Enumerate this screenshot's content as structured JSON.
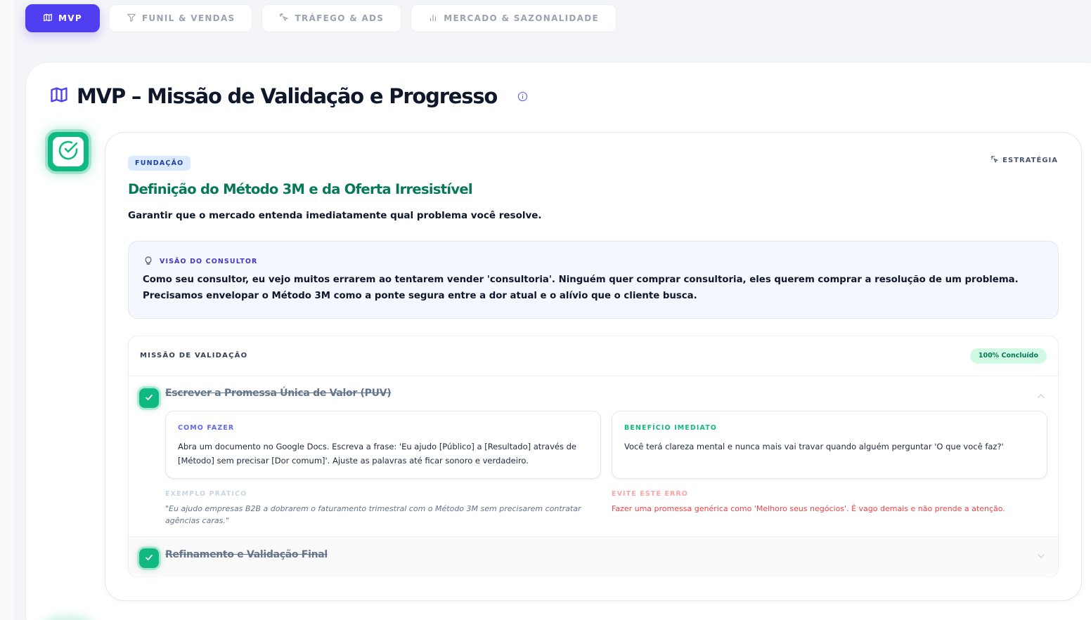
{
  "tabs": [
    {
      "label": "MVP",
      "icon": "map-icon",
      "active": true
    },
    {
      "label": "FUNIL & VENDAS",
      "icon": "filter-icon",
      "active": false
    },
    {
      "label": "TRÁFEGO & ADS",
      "icon": "cursor-click-icon",
      "active": false
    },
    {
      "label": "MERCADO & SAZONALIDADE",
      "icon": "bar-chart-icon",
      "active": false
    }
  ],
  "page": {
    "title": "MVP – Missão de Validação e Progresso",
    "title_icon": "map-icon",
    "info_icon": "info-icon"
  },
  "step": {
    "badge_icon": "check-circle-icon",
    "phase": "FUNDAÇÃO",
    "strategy_label": "ESTRATÉGIA",
    "title": "Definição do Método 3M e da Oferta Irresistível",
    "subtitle": "Garantir que o mercado entenda imediatamente qual problema você resolve."
  },
  "consultant": {
    "label": "VISÃO DO CONSULTOR",
    "icon": "lightbulb-icon",
    "text": "Como seu consultor, eu vejo muitos errarem ao tentarem vender 'consultoria'. Ninguém quer comprar consultoria, eles querem comprar a resolução de um problema. Precisamos envelopar o Método 3M como a ponte segura entre a dor atual e o alívio que o cliente busca."
  },
  "mission": {
    "heading": "MISSÃO DE VALIDAÇÃO",
    "progress": "100% Concluído",
    "progress_value": 1.0,
    "items": [
      {
        "title": "Escrever a Promessa Única de Valor (PUV)",
        "done": true,
        "expanded": true,
        "how_label": "COMO FAZER",
        "how_text": "Abra um documento no Google Docs. Escreva a frase: 'Eu ajudo [Público] a [Resultado] através de [Método] sem precisar [Dor comum]'. Ajuste as palavras até ficar sonoro e verdadeiro.",
        "benefit_label": "BENEFÍCIO IMEDIATO",
        "benefit_text": "Você terá clareza mental e nunca mais vai travar quando alguém perguntar 'O que você faz?'",
        "example_label": "EXEMPLO PRÁTICO",
        "example_text": "\"Eu ajudo empresas B2B a dobrarem o faturamento trimestral com o Método 3M sem precisarem contratar agências caras.\"",
        "error_label": "EVITE ESTE ERRO",
        "error_text": "Fazer uma promessa genérica como 'Melhoro seus negócios'. É vago demais e não prende a atenção."
      },
      {
        "title": "Refinamento e Validação Final",
        "done": true,
        "expanded": false
      }
    ]
  },
  "colors": {
    "accent": "#4f3ff0",
    "success": "#10b981",
    "success_dark": "#047857",
    "error": "#ef4444",
    "muted": "#9aa3b2"
  }
}
